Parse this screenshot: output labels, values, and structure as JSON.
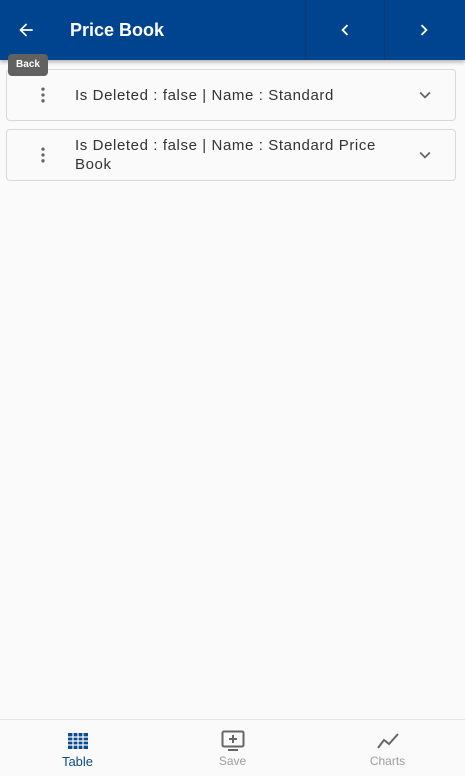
{
  "header": {
    "title": "Price Book",
    "back_tooltip": "Back"
  },
  "records": [
    {
      "text": "Is Deleted  : false | Name  : Standard"
    },
    {
      "text": "Is Deleted  : false | Name  : Standard Price Book"
    }
  ],
  "bottom_nav": {
    "items": [
      {
        "label": "Table",
        "icon": "table-icon",
        "active": true
      },
      {
        "label": "Save",
        "icon": "save-icon",
        "active": false
      },
      {
        "label": "Charts",
        "icon": "chart-icon",
        "active": false
      }
    ]
  },
  "colors": {
    "primary": "#00448f",
    "active": "#0d4a8f",
    "inactive": "#9e9e9e"
  }
}
